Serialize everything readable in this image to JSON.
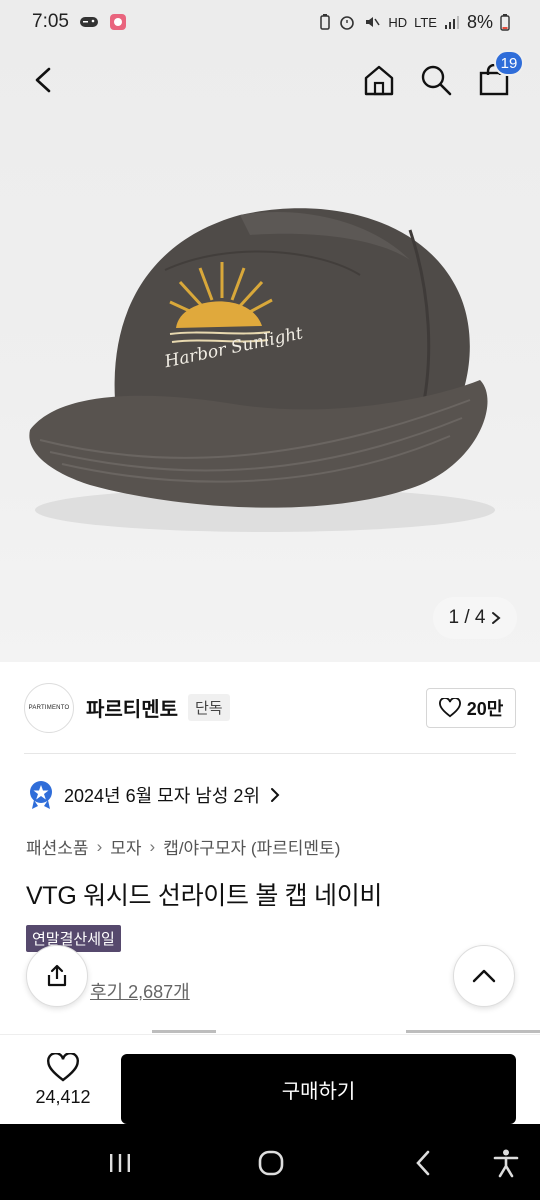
{
  "status": {
    "time": "7:05",
    "battery_text": "8%",
    "network_hd": "HD",
    "network_lte": "LTE"
  },
  "colors": {
    "cart_badge": "#2f6dd9",
    "sale_tag": "#56496d",
    "buy_button": "#000000"
  },
  "nav": {
    "cart_count": "19",
    "icons": [
      "back-arrow-icon",
      "home-icon",
      "search-icon",
      "cart-icon"
    ]
  },
  "gallery": {
    "pager": "1 / 4",
    "image_alt_text": "Harbor Sunlight"
  },
  "brand": {
    "logo_text": "PARTIMENTO",
    "name": "파르티멘토",
    "badge": "단독",
    "likes": "20만"
  },
  "ranking": {
    "text": "2024년 6월 모자 남성 2위"
  },
  "breadcrumb": [
    "패션소품",
    "모자",
    "캡/야구모자 (파르티멘토)"
  ],
  "product": {
    "title": "VTG 워시드 선라이트 볼 캡 네이비",
    "sale_tag": "연말결산세일",
    "reviews": "후기 2,687개"
  },
  "action_bar": {
    "wish_count": "24,412",
    "buy_label": "구매하기"
  }
}
